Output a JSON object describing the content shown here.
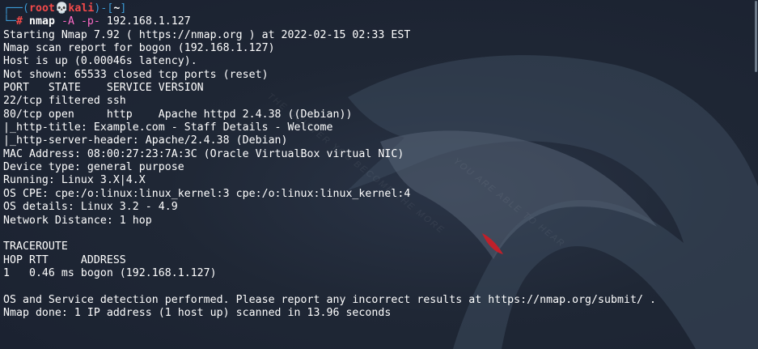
{
  "prompt": {
    "bracket_open": "┌──(",
    "user": "root",
    "skull": "💀",
    "host": "kali",
    "bracket_mid": ")-[",
    "cwd": "~",
    "bracket_close": "]",
    "corner": "└─",
    "symbol": "#",
    "command": "nmap",
    "flag_a": "-A",
    "flag_p": "-p-",
    "target": "192.168.1.127"
  },
  "output_lines": [
    "Starting Nmap 7.92 ( https://nmap.org ) at 2022-02-15 02:33 EST",
    "Nmap scan report for bogon (192.168.1.127)",
    "Host is up (0.00046s latency).",
    "Not shown: 65533 closed tcp ports (reset)",
    "PORT   STATE    SERVICE VERSION",
    "22/tcp filtered ssh",
    "80/tcp open     http    Apache httpd 2.4.38 ((Debian))",
    "|_http-title: Example.com - Staff Details - Welcome",
    "|_http-server-header: Apache/2.4.38 (Debian)",
    "MAC Address: 08:00:27:23:7A:3C (Oracle VirtualBox virtual NIC)",
    "Device type: general purpose",
    "Running: Linux 3.X|4.X",
    "OS CPE: cpe:/o:linux:linux_kernel:3 cpe:/o:linux:linux_kernel:4",
    "OS details: Linux 3.2 - 4.9",
    "Network Distance: 1 hop",
    "",
    "TRACEROUTE",
    "HOP RTT     ADDRESS",
    "1   0.46 ms bogon (192.168.1.127)",
    "",
    "OS and Service detection performed. Please report any incorrect results at https://nmap.org/submit/ .",
    "Nmap done: 1 IP address (1 host up) scanned in 13.96 seconds"
  ],
  "colors": {
    "background": "#1f2735",
    "prompt_frame": "#3c9bd6",
    "prompt_user": "#f44a4a",
    "flags": "#ff6bc8",
    "text": "#ffffff",
    "dragon_eye": "#c0202a"
  }
}
